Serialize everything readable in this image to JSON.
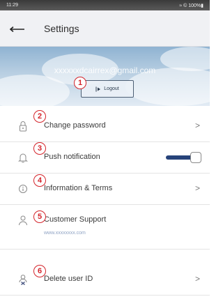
{
  "statusbar": {
    "time": "11:29",
    "indicators": "≈ © 100%▮"
  },
  "header": {
    "title": "Settings",
    "back_icon": "arrow-left-icon"
  },
  "account": {
    "email": "xxxxxxdcairrex@gmail.com",
    "logout_label": "Logout",
    "logout_icon": "logout-icon"
  },
  "badges": [
    "1",
    "2",
    "3",
    "4",
    "5",
    "6"
  ],
  "menu": {
    "change_password": {
      "label": "Change password",
      "icon": "lock-icon"
    },
    "push_notification": {
      "label": "Push notification",
      "icon": "bell-icon",
      "enabled": true
    },
    "info_terms": {
      "label": "Information & Terms",
      "icon": "info-icon"
    },
    "support": {
      "label": "Customer Support",
      "icon": "person-icon",
      "url": "www.xxxxxxxx.com"
    },
    "delete_user": {
      "label": "Delete user ID",
      "icon": "remove-user-icon"
    }
  },
  "colors": {
    "badge": "#d4232a",
    "toggle_on": "#27437a"
  }
}
